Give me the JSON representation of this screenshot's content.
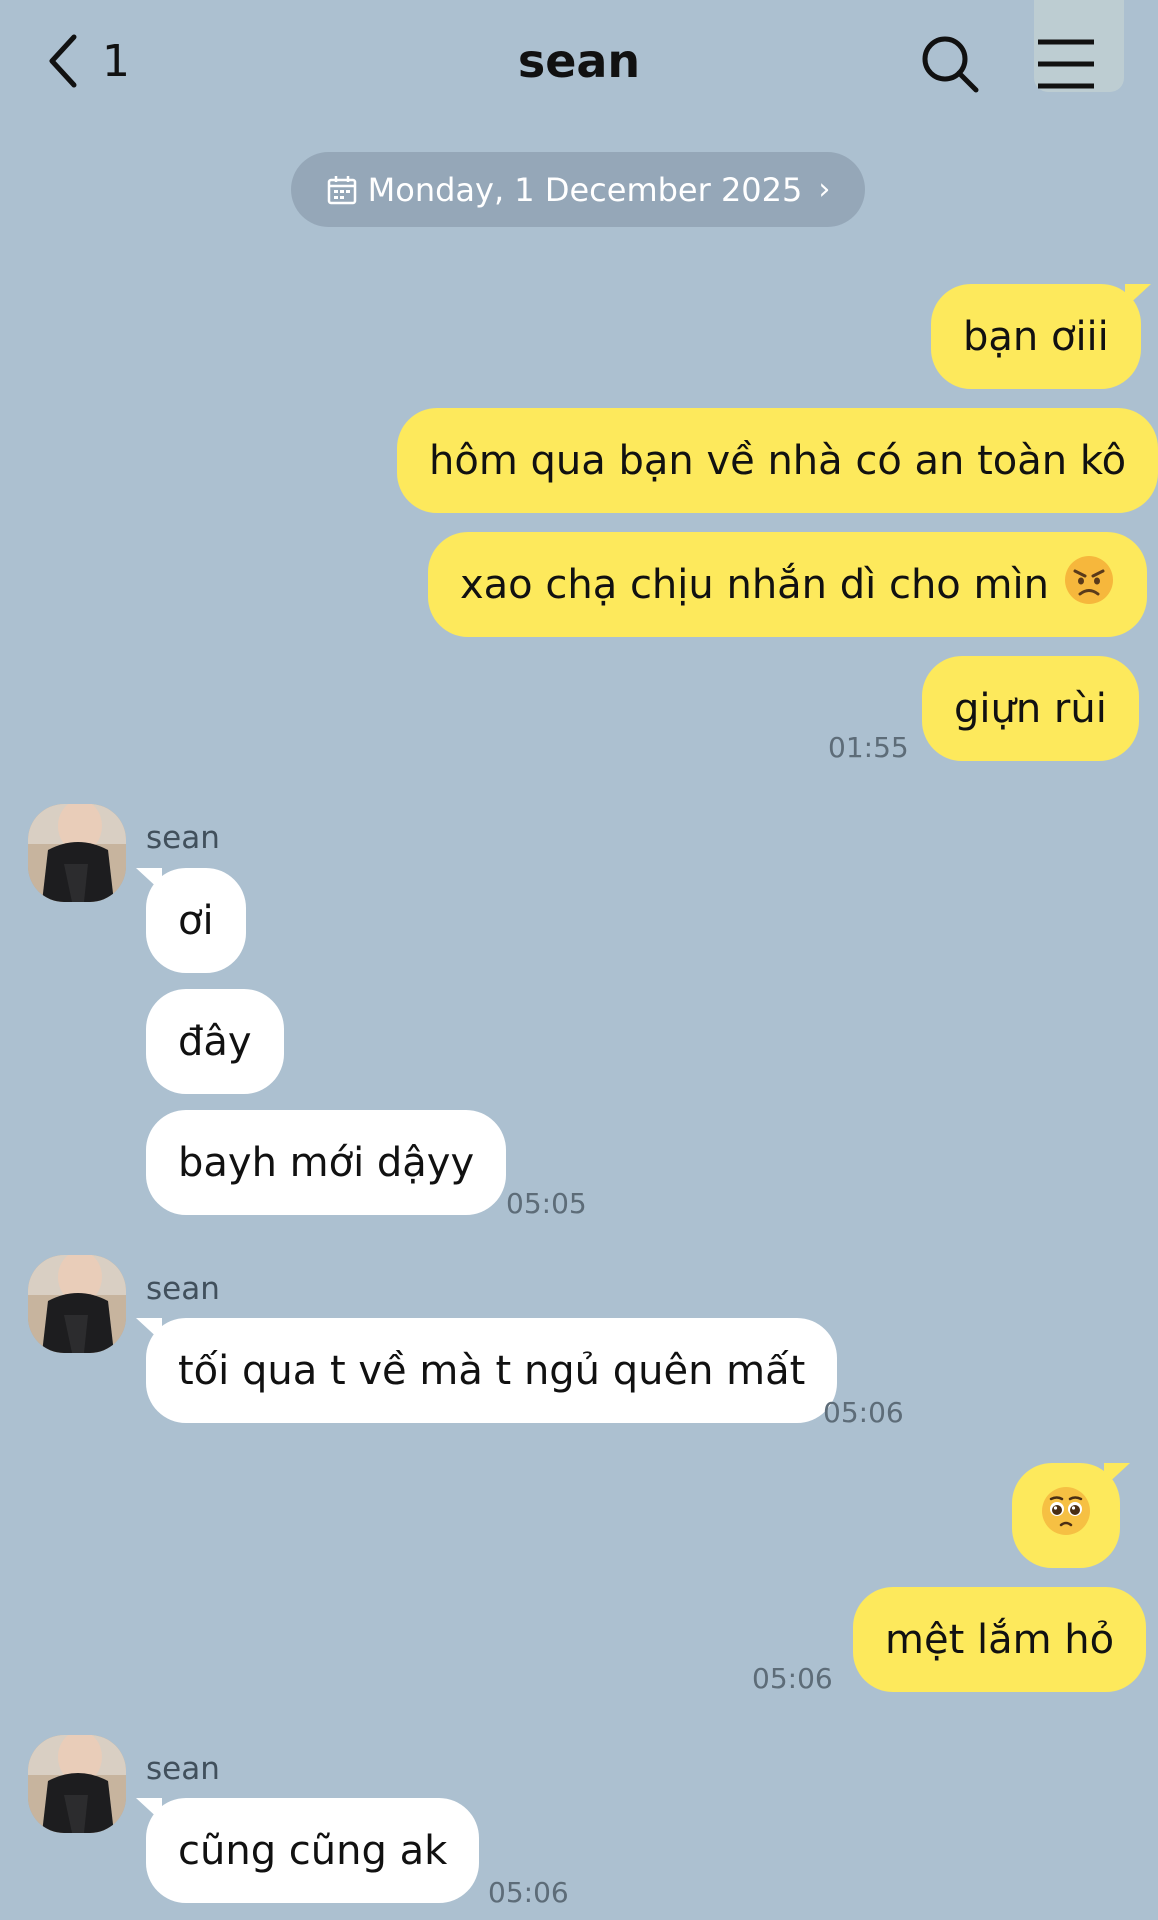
{
  "header": {
    "back_count": "1",
    "title": "sean"
  },
  "date_pill": {
    "label": "Monday, 1 December 2025",
    "chevron": "›"
  },
  "colors": {
    "background": "#acc0d0",
    "outgoing_bubble": "#fde95c",
    "incoming_bubble": "#ffffff",
    "date_pill": "#95a7b8"
  },
  "icons": {
    "back": "chevron-left-icon",
    "search": "search-icon",
    "menu": "hamburger-menu-icon",
    "calendar": "calendar-icon"
  },
  "messages": {
    "m1": {
      "text": "bạn ơiii",
      "direction": "outgoing"
    },
    "m2": {
      "text": "hôm qua bạn về nhà có an toàn kô",
      "direction": "outgoing"
    },
    "m3": {
      "text": "xao chạ chịu nhắn dì cho mìn",
      "emoji": "angry-face-emoji",
      "direction": "outgoing"
    },
    "m4": {
      "text": "giựn rùi",
      "time": "01:55",
      "direction": "outgoing"
    },
    "g1": {
      "sender": "sean"
    },
    "m5": {
      "text": "ơi",
      "direction": "incoming"
    },
    "m6": {
      "text": "đây",
      "direction": "incoming"
    },
    "m7": {
      "text": "bayh mới dậyy",
      "time": "05:05",
      "direction": "incoming"
    },
    "g2": {
      "sender": "sean"
    },
    "m8": {
      "text": "tối qua t về mà t ngủ quên mất",
      "time": "05:06",
      "direction": "incoming"
    },
    "m9": {
      "emoji": "pleading-face-emoji",
      "direction": "outgoing"
    },
    "m10": {
      "text": "mệt lắm hỏ",
      "time": "05:06",
      "direction": "outgoing"
    },
    "g3": {
      "sender": "sean"
    },
    "m11": {
      "text": "cũng cũng ak",
      "time": "05:06",
      "direction": "incoming"
    }
  }
}
